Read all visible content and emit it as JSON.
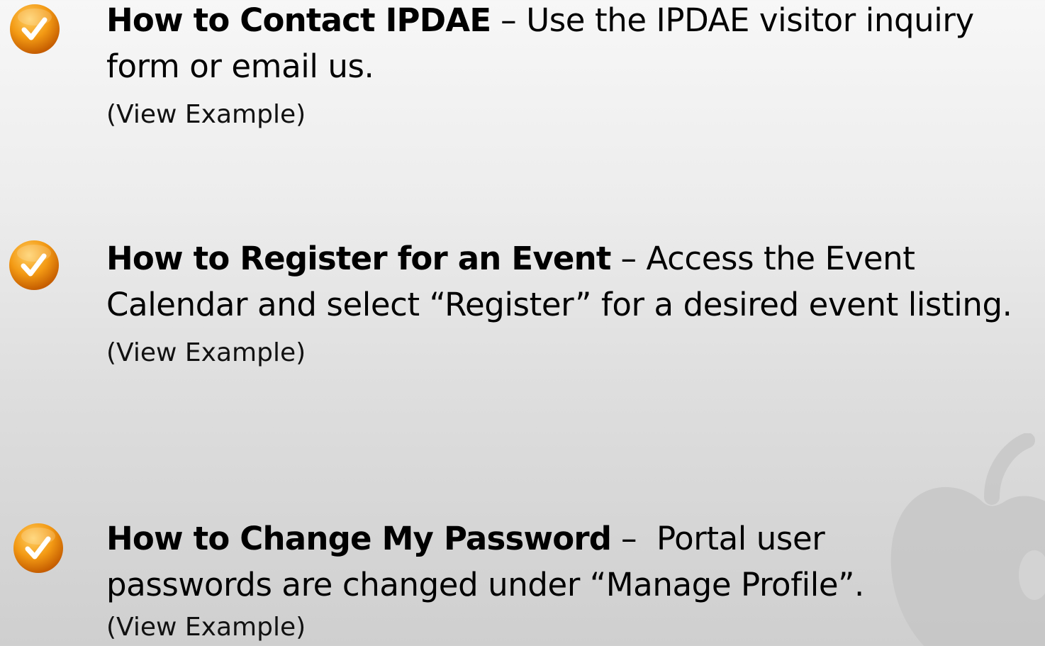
{
  "items": [
    {
      "title": "How to Contact IPDAE",
      "separator": " – ",
      "description": "Use the IPDAE visitor inquiry form or email us.",
      "example_link": "(View Example)",
      "icon": "checkmark-icon"
    },
    {
      "title": "How to Register for an Event",
      "separator": " – ",
      "description": "Access the Event Calendar and select “Register” for a desired event listing.",
      "example_link": "(View Example)",
      "icon": "checkmark-icon"
    },
    {
      "title": "How to Change My Password",
      "separator": " –  ",
      "description": "Portal user passwords are changed under “Manage Profile”.",
      "example_link": "(View Example)",
      "icon": "checkmark-icon"
    }
  ],
  "colors": {
    "icon_orange_light": "#f9b233",
    "icon_orange_dark": "#d46a00",
    "check_white": "#ffffff"
  }
}
